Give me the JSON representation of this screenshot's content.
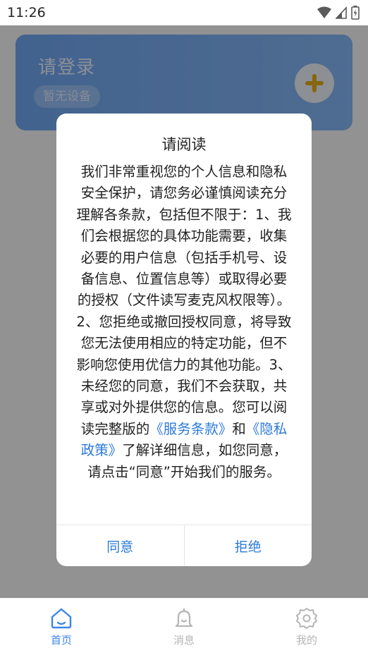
{
  "status_bar": {
    "time": "11:26"
  },
  "card": {
    "title": "请登录",
    "badge": "暂无设备"
  },
  "dialog": {
    "title": "请阅读",
    "body_before_links": "我们非常重视您的个人信息和隐私安全保护，请您务必谨慎阅读充分理解各条款，包括但不限于：1、我们会根据您的具体功能需要，收集必要的用户信息（包括手机号、设备信息、位置信息等）或取得必要的授权（文件读写麦克风权限等）。2、您拒绝或撤回授权同意，将导致您无法使用相应的特定功能，但不影响您使用优信力的其他功能。3、未经您的同意，我们不会获取，共享或对外提供您的信息。您可以阅读完整版的",
    "terms_link": "《服务条款》",
    "and_text": "和",
    "privacy_link": "《隐私政策》",
    "body_after_links": "了解详细信息，如您同意，请点击“同意”开始我们的服务。",
    "agree_label": "同意",
    "reject_label": "拒绝"
  },
  "nav": {
    "items": [
      {
        "label": "首页",
        "icon": "home-icon",
        "active": true
      },
      {
        "label": "消息",
        "icon": "bell-icon",
        "active": false
      },
      {
        "label": "我的",
        "icon": "gear-icon",
        "active": false
      }
    ]
  },
  "colors": {
    "accent": "#2b7ad8",
    "card": "#7aacf0",
    "add_icon": "#e1ab18"
  }
}
